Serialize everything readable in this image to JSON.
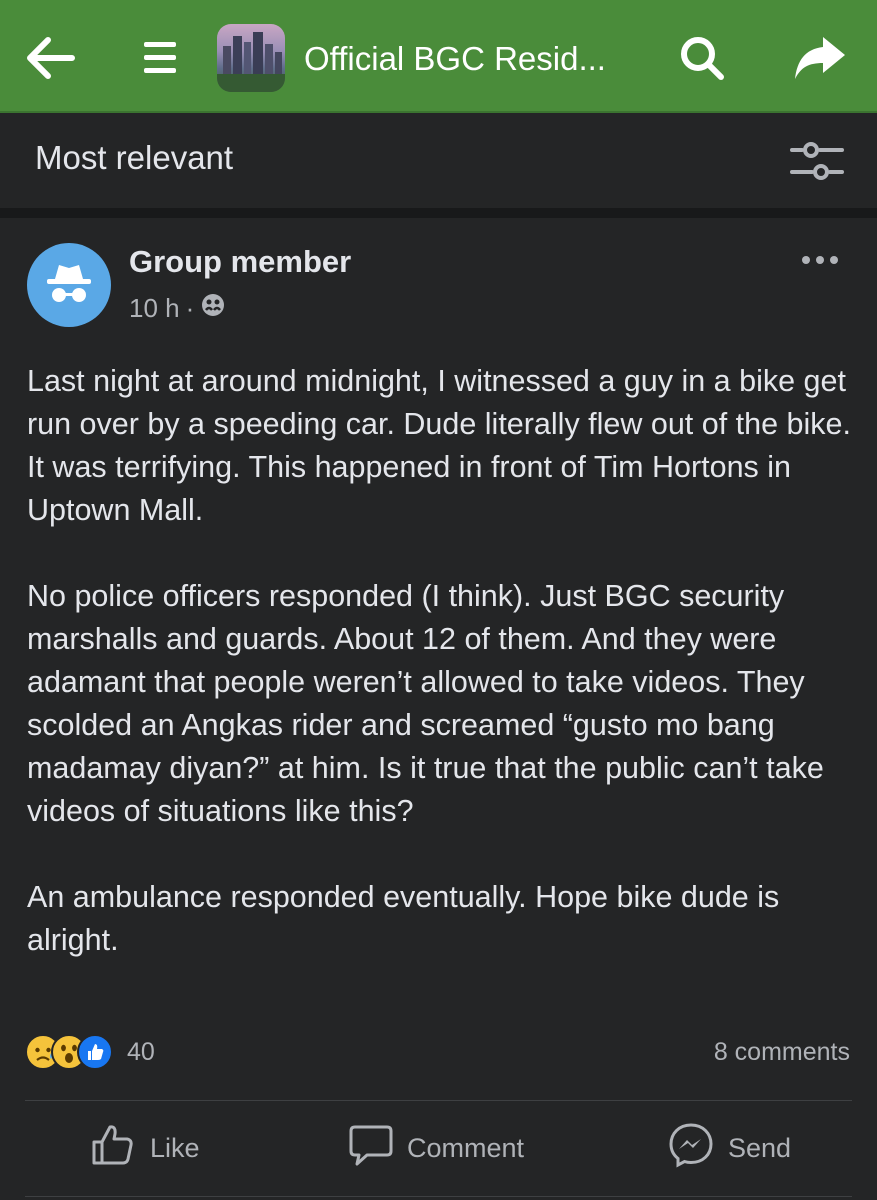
{
  "header": {
    "title": "Official BGC Resid...",
    "icons": [
      "back-arrow-icon",
      "hamburger-menu-icon",
      "group-thumbnail",
      "search-icon",
      "share-icon"
    ],
    "bar_color": "#4a8c3a"
  },
  "sort": {
    "label": "Most relevant",
    "icon": "filter-sliders-icon"
  },
  "post": {
    "author": "Group member",
    "time": "10 h",
    "separator": "·",
    "audience_icon": "group-audience-icon",
    "paragraphs": [
      "Last night at around midnight, I witnessed a guy in a bike get run over by a speeding car. Dude literally flew out of the bike. It was terrifying. This happened in front of Tim Hortons in Uptown Mall.",
      "No police officers responded (I think). Just BGC security marshalls and guards. About 12 of them. And they were adamant that people weren’t allowed to take videos. They scolded an Angkas rider and screamed “gusto mo bang madamay diyan?” at him. Is it true that the public can’t take videos of situations like this?",
      "An ambulance responded eventually. Hope bike dude is alright."
    ],
    "reaction_icons": [
      "sad-reaction-icon",
      "wow-reaction-icon",
      "like-reaction-icon"
    ],
    "reaction_count": "40",
    "comments": "8 comments"
  },
  "actions": {
    "like": "Like",
    "comment": "Comment",
    "send": "Send"
  },
  "colors": {
    "background": "#242526",
    "text": "#e4e6eb",
    "muted": "#b0b3b8",
    "avatar": "#5aa8e6",
    "like_blue": "#1877f2"
  }
}
